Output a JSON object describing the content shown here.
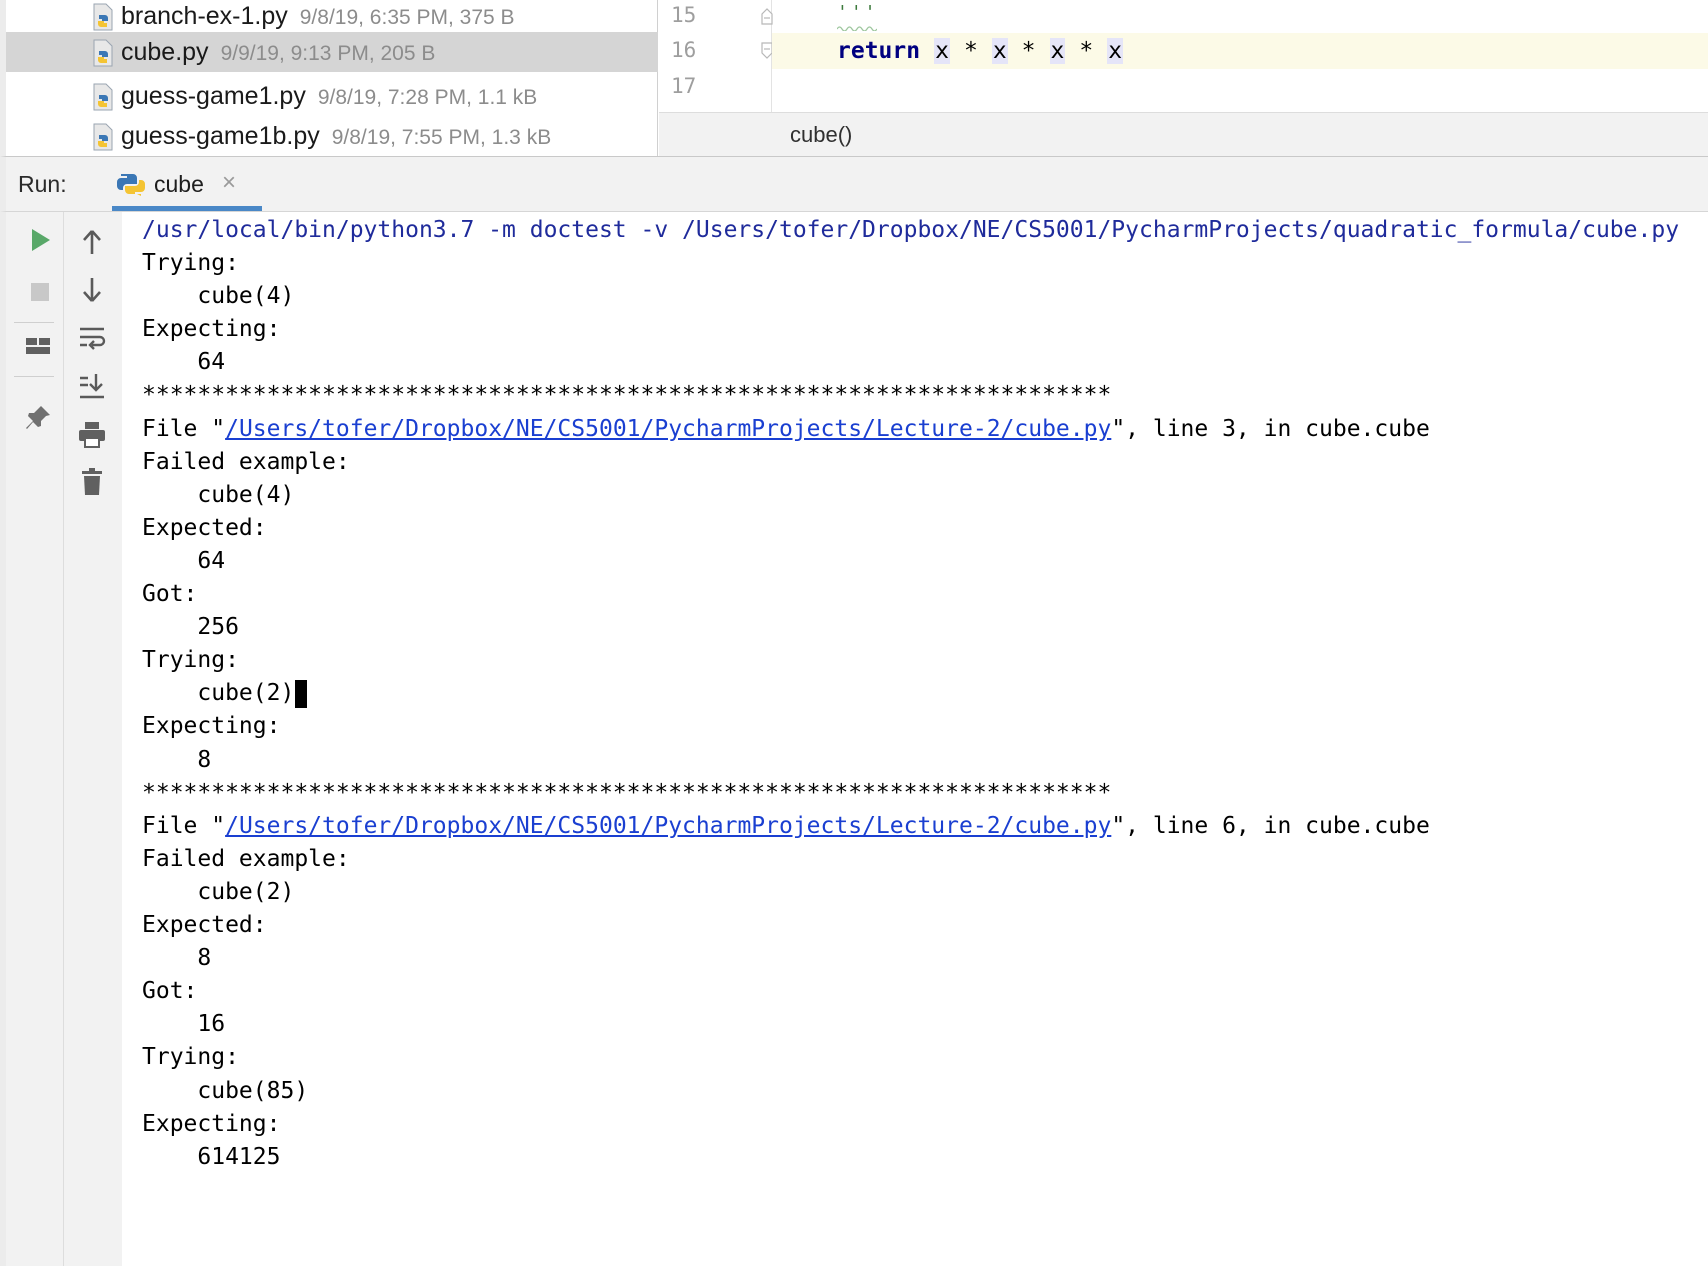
{
  "project_files": [
    {
      "name": "branch-ex-1.py",
      "meta": "9/8/19, 6:35 PM, 375 B",
      "selected": false
    },
    {
      "name": "cube.py",
      "meta": "9/9/19, 9:13 PM, 205 B",
      "selected": true
    },
    {
      "name": "guess-game1.py",
      "meta": "9/8/19, 7:28 PM, 1.1 kB",
      "selected": false
    },
    {
      "name": "guess-game1b.py",
      "meta": "9/8/19, 7:55 PM, 1.3 kB",
      "selected": false
    }
  ],
  "editor": {
    "line_numbers": [
      "15",
      "16",
      "17"
    ],
    "line15_text": "'''",
    "line16": {
      "keyword": "return",
      "tokens": [
        "x",
        "*",
        "x",
        "*",
        "x",
        "*",
        "x"
      ]
    },
    "breadcrumb": "cube()"
  },
  "run_window": {
    "label": "Run:",
    "tab_label": "cube",
    "tab_close": "×"
  },
  "toolbar": {
    "run_icon": "play-icon",
    "stop_icon": "stop-icon",
    "layout_icon": "layout-icon",
    "pin_icon": "pin-icon",
    "up_icon": "arrow-up-icon",
    "down_icon": "arrow-down-icon",
    "wrap_icon": "soft-wrap-icon",
    "scroll_end_icon": "scroll-to-end-icon",
    "print_icon": "print-icon",
    "trash_icon": "trash-icon"
  },
  "console": {
    "command": "/usr/local/bin/python3.7 -m doctest -v /Users/tofer/Dropbox/NE/CS5001/PycharmProjects/quadratic_formula/cube.py",
    "lines": [
      "Trying:",
      "    cube(4)",
      "Expecting:",
      "    64",
      "**********************************************************************",
      "FILE_LINE_1",
      "Failed example:",
      "    cube(4)",
      "Expected:",
      "    64",
      "Got:",
      "    256",
      "Trying:",
      "    cube(2)",
      "Expecting:",
      "    8",
      "**********************************************************************",
      "FILE_LINE_2",
      "Failed example:",
      "    cube(2)",
      "Expected:",
      "    8",
      "Got:",
      "    16",
      "Trying:",
      "    cube(85)",
      "Expecting:",
      "    614125"
    ],
    "file_prefix": "File \"",
    "file_link": "/Users/tofer/Dropbox/NE/CS5001/PycharmProjects/Lecture-2/cube.py",
    "file_suffix_1": "\", line 3, in cube.cube",
    "file_suffix_2": "\", line 6, in cube.cube",
    "caret_after_line_index": 13
  },
  "colors": {
    "accent_tab": "#4a88c7",
    "run_green": "#59a869",
    "keyword": "#000080",
    "command_text": "#1f2b9b",
    "link": "#1a3fd1"
  }
}
